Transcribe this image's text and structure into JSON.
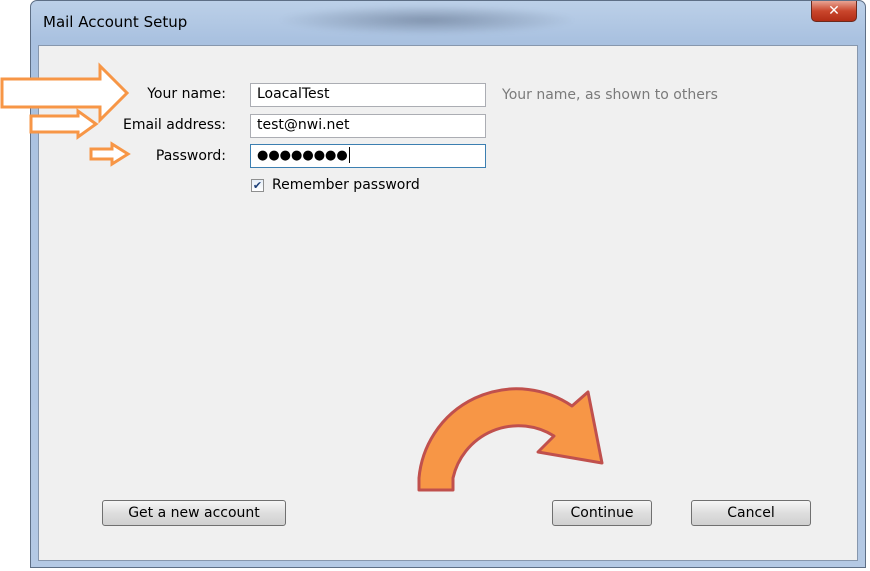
{
  "window": {
    "title": "Mail Account Setup",
    "close_glyph": "✕"
  },
  "form": {
    "name_label": "Your name:",
    "name_value": "LoacalTest",
    "name_hint": "Your name, as shown to others",
    "email_label": "Email address:",
    "email_value": "test@nwi.net",
    "password_label": "Password:",
    "password_masked": "●●●●●●●●",
    "remember_label": "Remember password",
    "remember_checked": true,
    "check_glyph": "✔"
  },
  "buttons": {
    "new_account": "Get a new account",
    "continue": "Continue",
    "cancel": "Cancel"
  },
  "annotations": {
    "arrow_color": "#f79646",
    "arrow_edge": "#c0504d"
  }
}
